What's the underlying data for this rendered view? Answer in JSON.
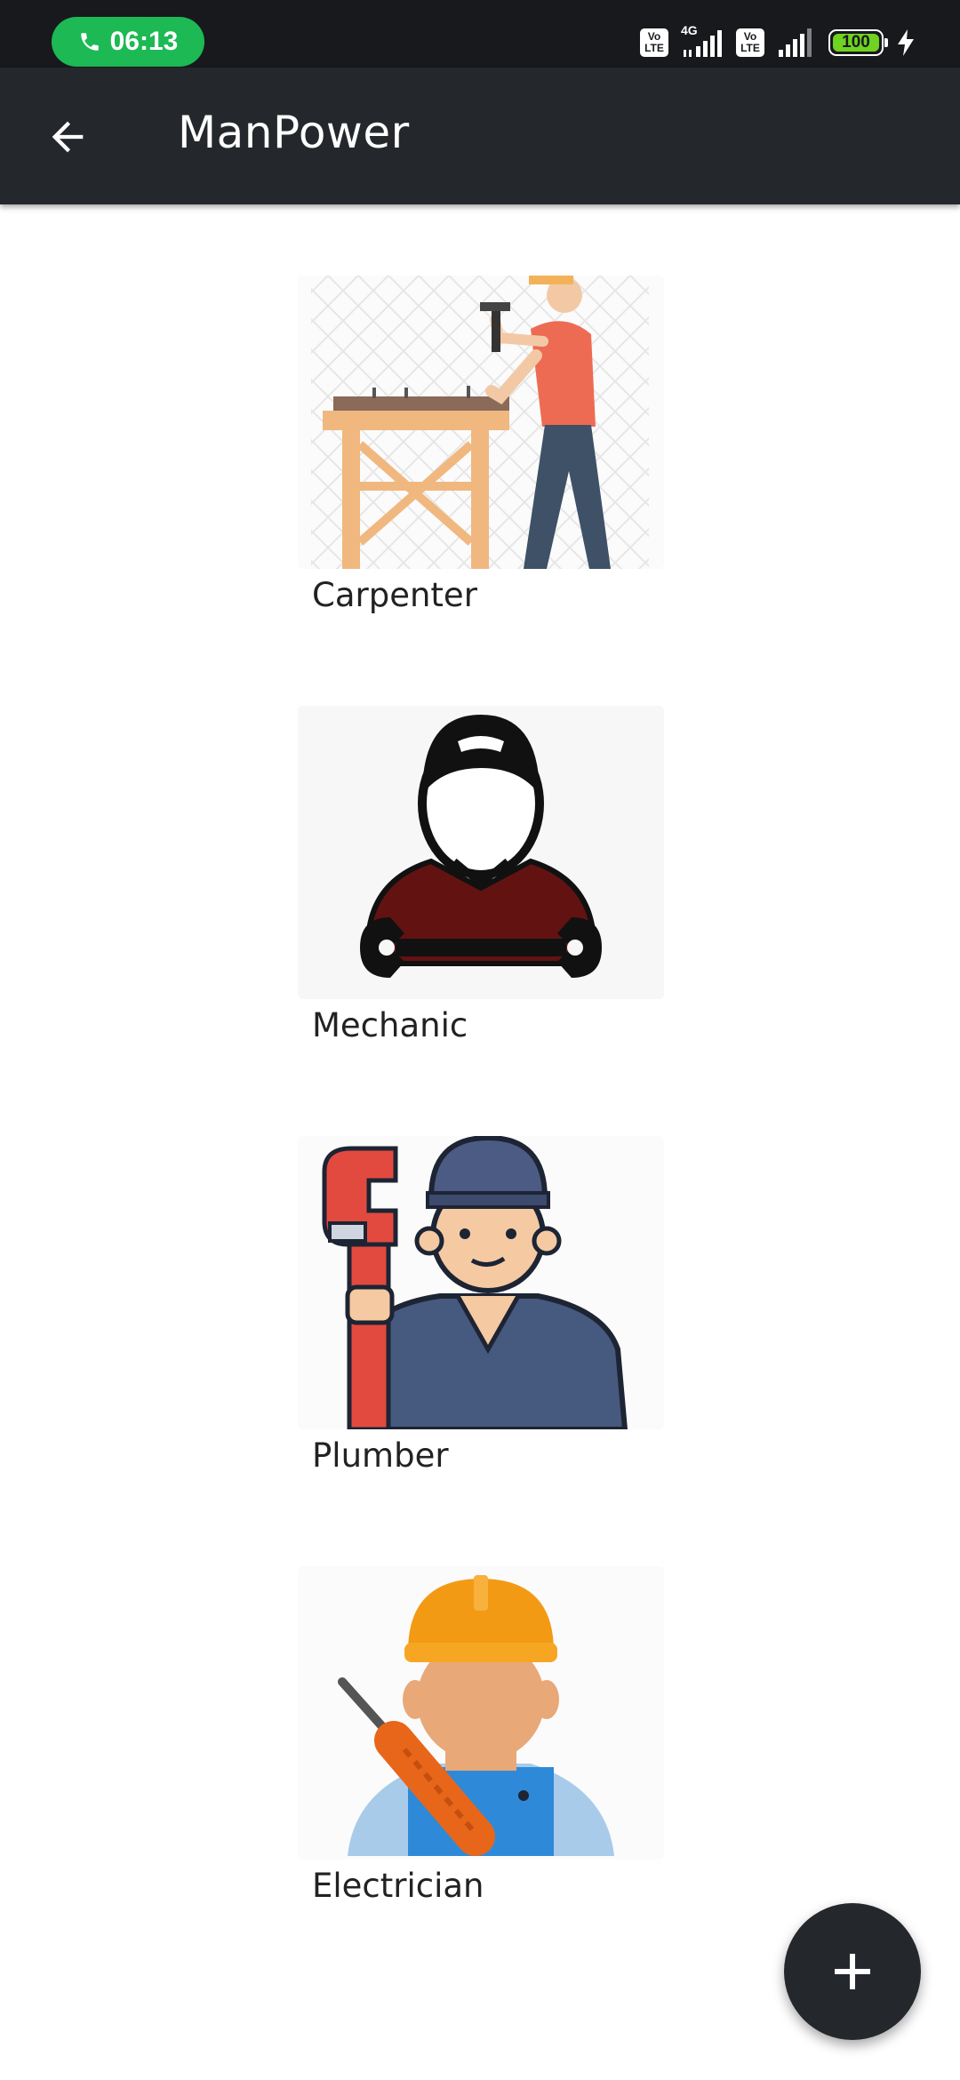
{
  "status_bar": {
    "time": "06:13",
    "call_icon": "phone-icon",
    "network_type": "4G",
    "sim1_label": [
      "Vo",
      "LTE"
    ],
    "sim2_label": [
      "Vo",
      "LTE"
    ],
    "battery_level": "100",
    "charging_icon": "bolt-icon",
    "call_pill_color": "#1db954",
    "battery_fill_color": "#6fd320"
  },
  "app_bar": {
    "title": "ManPower",
    "back_icon": "arrow-back-icon",
    "background": "#24282d"
  },
  "categories": [
    {
      "label": "Carpenter",
      "icon": "carpenter-illustration"
    },
    {
      "label": "Mechanic",
      "icon": "mechanic-illustration"
    },
    {
      "label": "Plumber",
      "icon": "plumber-illustration"
    },
    {
      "label": "Electrician",
      "icon": "electrician-illustration"
    }
  ],
  "fab": {
    "icon": "plus-icon",
    "background": "#24282d"
  }
}
